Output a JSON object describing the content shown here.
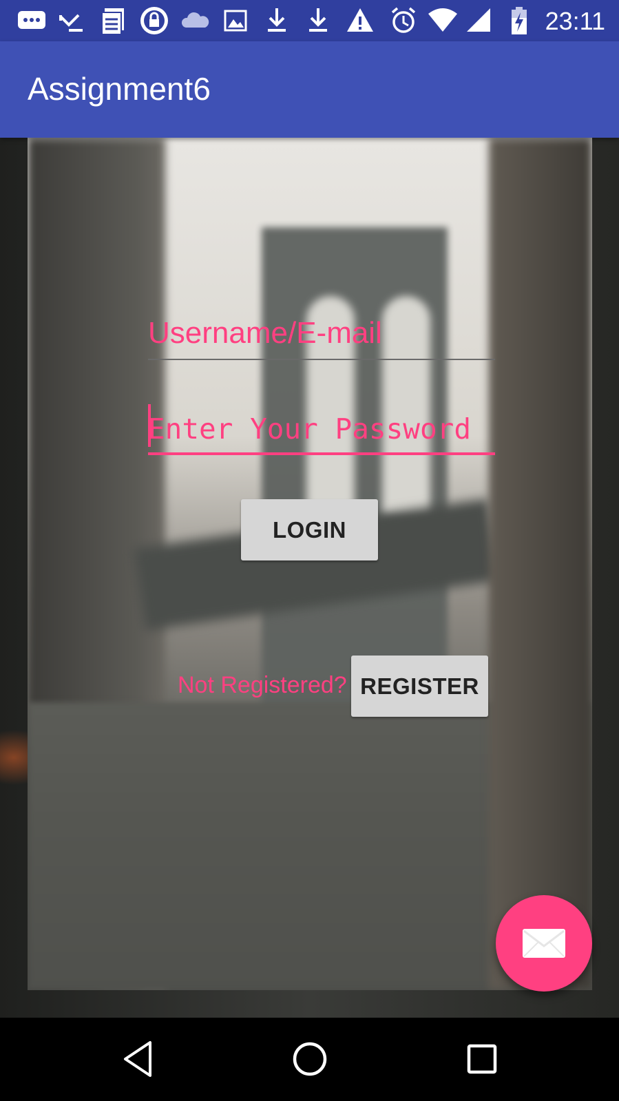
{
  "status_bar": {
    "time": "23:11",
    "icons": [
      "messenger-icon",
      "missed-call-icon",
      "news-icon",
      "vpn-lock-icon",
      "cloud-icon",
      "image-icon",
      "download-icon",
      "download-icon",
      "warning-icon",
      "alarm-icon",
      "wifi-icon",
      "signal-icon",
      "battery-charging-icon"
    ]
  },
  "app_bar": {
    "title": "Assignment6"
  },
  "form": {
    "username_placeholder": "Username/E-mail",
    "password_placeholder": "Enter Your Password",
    "login_label": "LOGIN",
    "not_registered_text": "Not Registered?",
    "register_label": "REGISTER"
  },
  "fab": {
    "icon": "email-icon"
  },
  "nav_bar": {
    "icons": [
      "back-icon",
      "home-icon",
      "recents-icon"
    ]
  },
  "colors": {
    "primary": "#3f51b5",
    "primary_dark": "#303f9f",
    "accent": "#ff4081"
  }
}
